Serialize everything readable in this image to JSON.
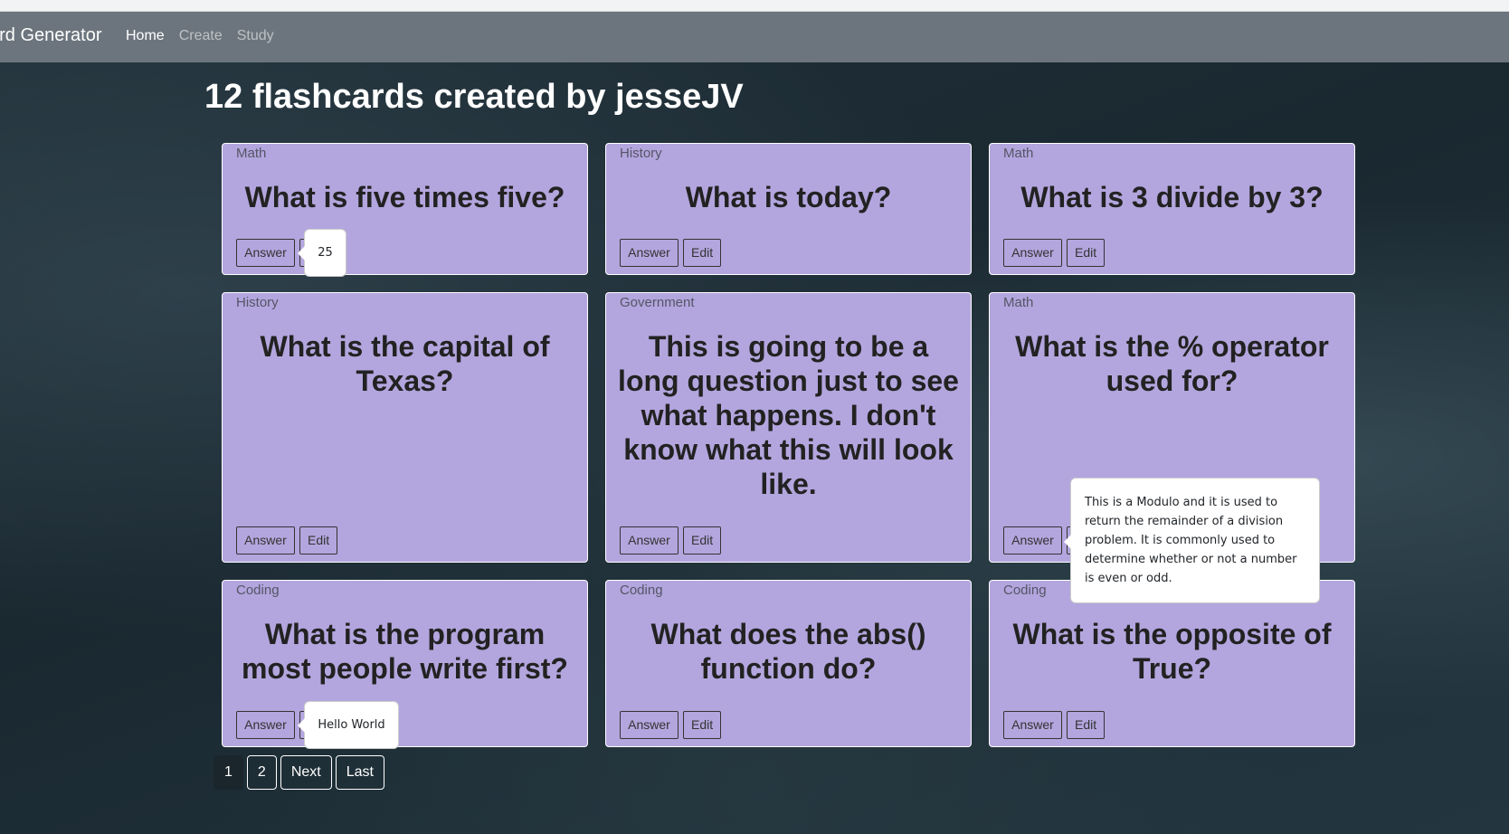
{
  "navbar": {
    "brand": "ard Generator",
    "links": [
      {
        "label": "Home",
        "active": true
      },
      {
        "label": "Create",
        "active": false
      },
      {
        "label": "Study",
        "active": false
      }
    ]
  },
  "heading": "12 flashcards created by jesseJV",
  "buttons": {
    "answer": "Answer",
    "edit": "Edit"
  },
  "cards": [
    {
      "category": "Math",
      "question": "What is five times five?"
    },
    {
      "category": "History",
      "question": "What is today?"
    },
    {
      "category": "Math",
      "question": "What is 3 divide by 3?"
    },
    {
      "category": "History",
      "question": "What is the capital of Texas?"
    },
    {
      "category": "Government",
      "question": "This is going to be a long question just to see what happens. I don't know what this will look like."
    },
    {
      "category": "Math",
      "question": "What is the % operator used for?"
    },
    {
      "category": "Coding",
      "question": "What is the program most people write first?"
    },
    {
      "category": "Coding",
      "question": "What does the abs() function do?"
    },
    {
      "category": "Coding",
      "question": "What is the opposite of True?"
    }
  ],
  "popovers": {
    "card1": "25",
    "card6": "This is a Modulo and it is used to return the remainder of a division problem. It is commonly used to determine whether or not a number is even or odd.",
    "card7": "Hello World"
  },
  "pagination": [
    "1",
    "2",
    "Next",
    "Last"
  ],
  "colors": {
    "navbar": "#6c757d",
    "card": "#b3a6de"
  }
}
